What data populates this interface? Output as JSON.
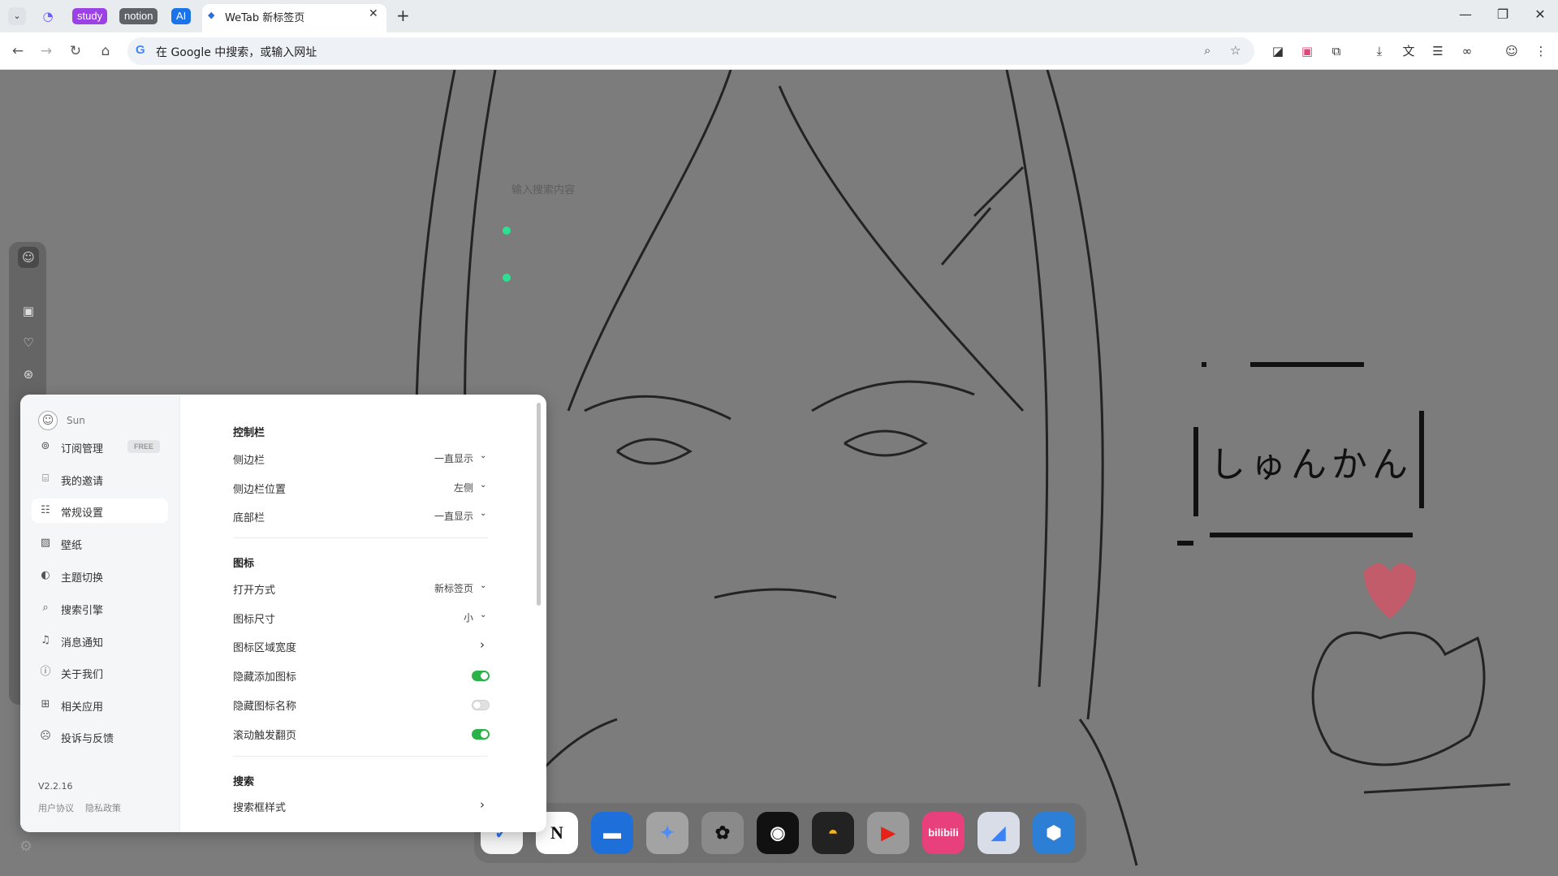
{
  "tabstrip": {
    "groups": [
      {
        "label": "study",
        "color": "#9b41e6"
      },
      {
        "label": "notion",
        "color": "#5f6368"
      },
      {
        "label": "AI",
        "color": "#1a73e8"
      }
    ],
    "active_tab_title": "WeTab 新标签页"
  },
  "toolbar": {
    "omnibox_placeholder": "在 Google 中搜索，或输入网址"
  },
  "wallpaper": {
    "speech_text": "しゅんかん"
  },
  "search": {
    "placeholder": "输入搜索内容"
  },
  "modal": {
    "user_name": "Sun",
    "menu": [
      {
        "label": "订阅管理",
        "badge": "FREE"
      },
      {
        "label": "我的邀请"
      },
      {
        "label": "常规设置"
      },
      {
        "label": "壁纸"
      },
      {
        "label": "主题切换"
      },
      {
        "label": "搜索引擎"
      },
      {
        "label": "消息通知"
      },
      {
        "label": "关于我们"
      },
      {
        "label": "相关应用"
      },
      {
        "label": "投诉与反馈"
      }
    ],
    "version": "V2.2.16",
    "links": [
      "用户协议",
      "隐私政策"
    ],
    "sections": {
      "control": {
        "title": "控制栏",
        "rows": [
          {
            "label": "侧边栏",
            "value": "一直显示"
          },
          {
            "label": "侧边栏位置",
            "value": "左侧"
          },
          {
            "label": "底部栏",
            "value": "一直显示"
          }
        ]
      },
      "icons": {
        "title": "图标",
        "rows": [
          {
            "label": "打开方式",
            "value": "新标签页"
          },
          {
            "label": "图标尺寸",
            "value": "小"
          },
          {
            "label": "图标区域宽度"
          },
          {
            "label": "隐藏添加图标",
            "on": true
          },
          {
            "label": "隐藏图标名称",
            "on": false
          },
          {
            "label": "滚动触发翻页",
            "on": true
          }
        ]
      },
      "search": {
        "title": "搜索",
        "rows": [
          {
            "label": "搜索框样式"
          }
        ]
      }
    }
  },
  "dock": {
    "apps": [
      "bilibili"
    ]
  },
  "colors": {
    "toggle_on": "#2bb34a",
    "accent_blue": "#1a73e8"
  }
}
